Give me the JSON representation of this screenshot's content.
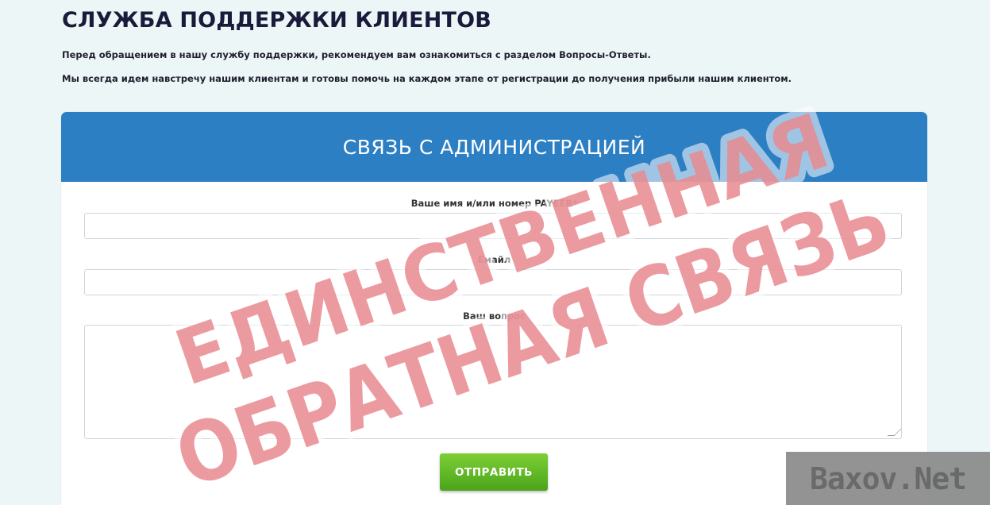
{
  "header": {
    "title": "СЛУЖБА ПОДДЕРЖКИ КЛИЕНТОВ",
    "intro_1": "Перед обращением в нашу службу поддержки, рекомендуем вам ознакомиться с разделом Вопросы-Ответы.",
    "intro_2": "Мы всегда идем навстречу нашим клиентам и готовы помочь на каждом этапе от регистрации до получения прибыли нашим клиентом."
  },
  "form": {
    "title": "СВЯЗЬ С АДМИНИСТРАЦИЕЙ",
    "name_label": "Ваше имя и/или номер PAYEER*",
    "name_value": "",
    "email_label": "Емайл",
    "email_value": "",
    "question_label": "Ваш вопрос",
    "question_value": "",
    "submit_label": "ОТПРАВИТЬ"
  },
  "overlay": {
    "stamp_line_1": "ЕДИНСТВЕННАЯ",
    "stamp_line_2": "ОБРАТНАЯ СВЯЗЬ",
    "badge": "Baxov.Net"
  },
  "colors": {
    "header_blue": "#2d7fc4",
    "button_green": "#5cb82a",
    "stamp_red": "#e88a8f",
    "stamp_blue": "#4b5a8a"
  }
}
